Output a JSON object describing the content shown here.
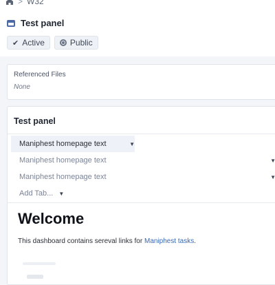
{
  "breadcrumb": {
    "separator": ">",
    "current": "W32",
    "home_icon": "home-icon"
  },
  "header": {
    "title": "Test panel",
    "tags": [
      {
        "label": "Active",
        "icon": "check-icon"
      },
      {
        "label": "Public",
        "icon": "globe-icon"
      }
    ]
  },
  "files": {
    "label": "Referenced Files",
    "value": "None"
  },
  "panel": {
    "title": "Test panel",
    "tabs": [
      {
        "label": "Maniphest homepage text",
        "active": true
      },
      {
        "label": "Maniphest homepage text",
        "active": false
      },
      {
        "label": "Maniphest homepage text",
        "active": false
      }
    ],
    "add_tab": "Add Tab...",
    "content": {
      "heading": "Welcome",
      "text": "This dashboard contains sereval links for ",
      "link": "Maniphest tasks",
      "text_end": "."
    }
  },
  "colors": {
    "accent": "#3767b6",
    "icon": "#4b6aa6"
  }
}
